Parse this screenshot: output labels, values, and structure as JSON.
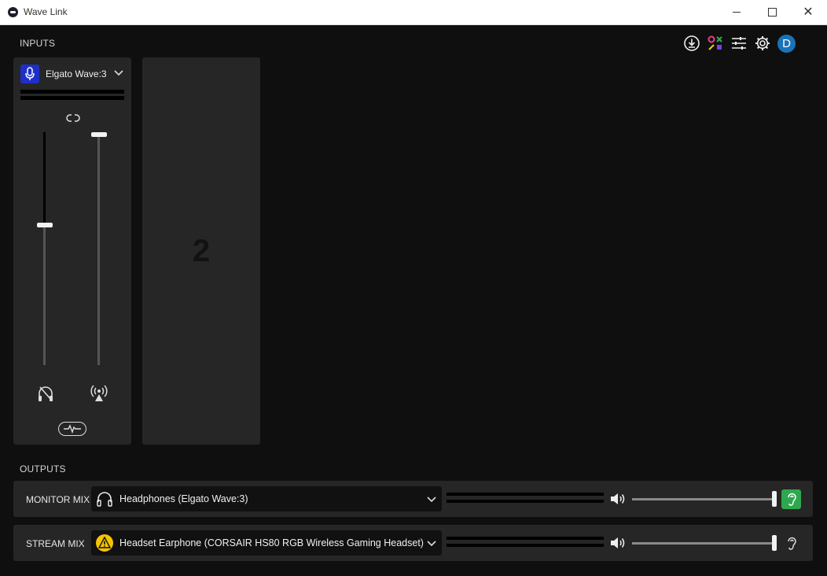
{
  "window": {
    "title": "Wave Link"
  },
  "inputs": {
    "section_label": "INPUTS",
    "channels": [
      {
        "device": "Elgato Wave:3",
        "icon": "microphone-icon",
        "accent": "#1e2fc9",
        "monitor_level": 0.6,
        "stream_level": 0.99
      },
      {
        "placeholder_number": "2"
      }
    ]
  },
  "toolbar": {
    "icons": [
      "download-icon",
      "marketplace-icon",
      "mixer-settings-icon",
      "gear-icon"
    ],
    "avatar_letter": "D",
    "avatar_color": "#1a73b8"
  },
  "outputs": {
    "section_label": "OUTPUTS",
    "rows": [
      {
        "label": "MONITOR MIX",
        "device": "Headphones (Elgato Wave:3)",
        "device_icon": "headphones-icon",
        "volume": 1.0,
        "listen_active": true,
        "listen_color": "#2ea84e"
      },
      {
        "label": "STREAM MIX",
        "device": "Headset Earphone (CORSAIR HS80 RGB Wireless Gaming Headset)",
        "device_icon": "warning-icon",
        "warning_color": "#f5c400",
        "volume": 1.0,
        "listen_active": false
      }
    ]
  }
}
